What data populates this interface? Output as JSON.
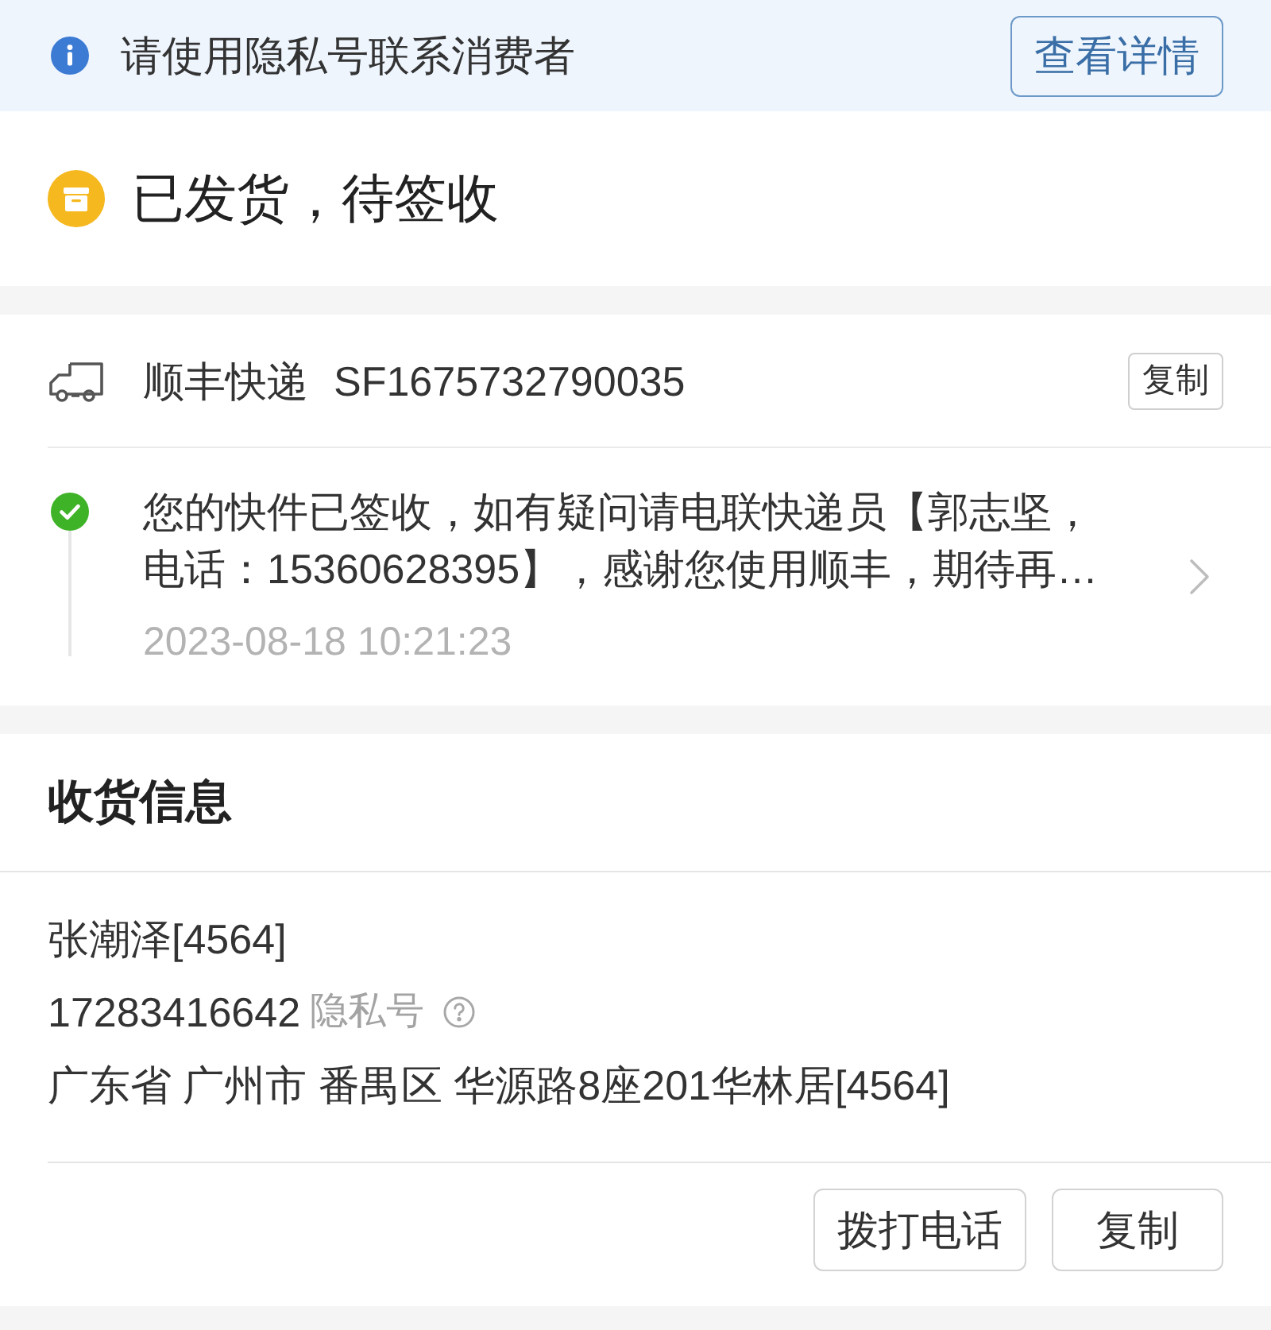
{
  "notice": {
    "text": "请使用隐私号联系消费者",
    "button": "查看详情"
  },
  "status": {
    "title": "已发货，待签收"
  },
  "shipment": {
    "carrier": "顺丰快递",
    "tracking_number": "SF1675732790035",
    "copy_button": "复制",
    "latest_event": {
      "text": "您的快件已签收，如有疑问请电联快递员【郭志坚，电话：15360628395】，感谢您使用顺丰，期待再…",
      "time": "2023-08-18 10:21:23"
    }
  },
  "receiver": {
    "title": "收货信息",
    "name": "张潮泽[4564]",
    "phone": "17283416642",
    "phone_tag": "隐私号",
    "address": "广东省 广州市 番禺区 华源路8座201华林居[4564]",
    "buttons": [
      "拨打电话",
      "复制"
    ]
  }
}
